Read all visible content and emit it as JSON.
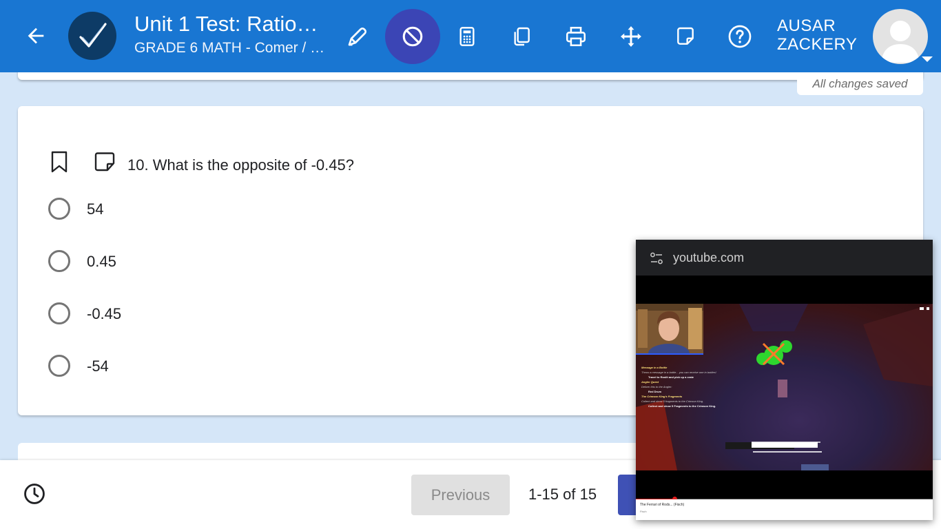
{
  "header": {
    "title": "Unit 1 Test: Ratio…",
    "subtitle": "GRADE 6 MATH - Comer / …",
    "user_name_line1": "AUSAR",
    "user_name_line2": "ZACKERY",
    "tools": [
      "highlighter-icon",
      "block-icon",
      "calculator-icon",
      "copy-icon",
      "print-icon",
      "move-icon",
      "sticky-note-icon",
      "help-icon"
    ],
    "accent_color": "#1976d2",
    "active_tool_color": "#3b45b5"
  },
  "status": {
    "saved_text": "All changes saved"
  },
  "question": {
    "text": "10. What is the opposite of -0.45?",
    "options": [
      "54",
      "0.45",
      "-0.45",
      "-54"
    ]
  },
  "footer": {
    "previous_label": "Previous",
    "page_count": "1-15 of 15"
  },
  "pip": {
    "site": "youtube.com",
    "video_caption": "The Ferrari of Rods... (Fisch)",
    "video_meta": "Fisch",
    "progress": 0.13,
    "overlay_quests": [
      {
        "title": "Message in a Bottle",
        "desc": "Throw a message in a bottle... you can receive one in bottles!",
        "task": "Travel to Roslit and pick up a crate"
      },
      {
        "title": "Angler Quest",
        "desc": "Deliver this to the Angler:",
        "task": "Red Drum"
      },
      {
        "title": "The Crimson King's Fragments",
        "desc": "Collect and show 5 fragments to the Crimson King.",
        "task": "Collect and show 5 Fragments to the Crimson King."
      }
    ]
  }
}
